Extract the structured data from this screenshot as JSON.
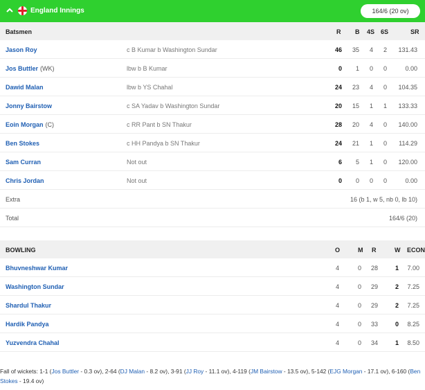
{
  "header": {
    "title": "England Innings",
    "score": "164/6 (20 ov)",
    "icons": [
      "chevron-up-icon",
      "england-flag-icon"
    ],
    "bg_color": "#2fd02f"
  },
  "batting": {
    "headers": {
      "name": "Batsmen",
      "r": "R",
      "b": "B",
      "fours": "4S",
      "sixes": "6S",
      "sr": "SR"
    },
    "rows": [
      {
        "name": "Jason Roy",
        "role": "",
        "dismissal": "c B Kumar b Washington Sundar",
        "r": "46",
        "b": "35",
        "fours": "4",
        "sixes": "2",
        "sr": "131.43"
      },
      {
        "name": "Jos Buttler",
        "role": "(WK)",
        "dismissal": "lbw b B Kumar",
        "r": "0",
        "b": "1",
        "fours": "0",
        "sixes": "0",
        "sr": "0.00"
      },
      {
        "name": "Dawid Malan",
        "role": "",
        "dismissal": "lbw b YS Chahal",
        "r": "24",
        "b": "23",
        "fours": "4",
        "sixes": "0",
        "sr": "104.35"
      },
      {
        "name": "Jonny Bairstow",
        "role": "",
        "dismissal": "c SA Yadav b Washington Sundar",
        "r": "20",
        "b": "15",
        "fours": "1",
        "sixes": "1",
        "sr": "133.33"
      },
      {
        "name": "Eoin Morgan",
        "role": "(C)",
        "dismissal": "c RR Pant b SN Thakur",
        "r": "28",
        "b": "20",
        "fours": "4",
        "sixes": "0",
        "sr": "140.00"
      },
      {
        "name": "Ben Stokes",
        "role": "",
        "dismissal": "c HH Pandya b SN Thakur",
        "r": "24",
        "b": "21",
        "fours": "1",
        "sixes": "0",
        "sr": "114.29"
      },
      {
        "name": "Sam Curran",
        "role": "",
        "dismissal": "Not out",
        "r": "6",
        "b": "5",
        "fours": "1",
        "sixes": "0",
        "sr": "120.00"
      },
      {
        "name": "Chris Jordan",
        "role": "",
        "dismissal": "Not out",
        "r": "0",
        "b": "0",
        "fours": "0",
        "sixes": "0",
        "sr": "0.00"
      }
    ],
    "extra": {
      "label": "Extra",
      "value": "16 (b 1, w 5, nb 0, lb 10)"
    },
    "total": {
      "label": "Total",
      "value": "164/6 (20)"
    }
  },
  "bowling": {
    "headers": {
      "name": "BOWLING",
      "o": "O",
      "m": "M",
      "r": "R",
      "w": "W",
      "econ": "ECON"
    },
    "rows": [
      {
        "name": "Bhuvneshwar Kumar",
        "o": "4",
        "m": "0",
        "r": "28",
        "w": "1",
        "econ": "7.00"
      },
      {
        "name": "Washington Sundar",
        "o": "4",
        "m": "0",
        "r": "29",
        "w": "2",
        "econ": "7.25"
      },
      {
        "name": "Shardul Thakur",
        "o": "4",
        "m": "0",
        "r": "29",
        "w": "2",
        "econ": "7.25"
      },
      {
        "name": "Hardik Pandya",
        "o": "4",
        "m": "0",
        "r": "33",
        "w": "0",
        "econ": "8.25"
      },
      {
        "name": "Yuzvendra Chahal",
        "o": "4",
        "m": "0",
        "r": "34",
        "w": "1",
        "econ": "8.50"
      }
    ]
  },
  "fall_of_wickets": {
    "label": "Fall of wickets:",
    "items": [
      {
        "pre": "1-1 (",
        "player": "Jos Buttler",
        "post": " - 0.3 ov), "
      },
      {
        "pre": "2-64 (",
        "player": "DJ Malan",
        "post": " - 8.2 ov), "
      },
      {
        "pre": "3-91 (",
        "player": "JJ Roy",
        "post": " - 11.1 ov), "
      },
      {
        "pre": "4-119 (",
        "player": "JM Bairstow",
        "post": " - 13.5 ov), "
      },
      {
        "pre": "5-142 (",
        "player": "EJG Morgan",
        "post": " - 17.1 ov), "
      },
      {
        "pre": "6-160 (",
        "player": "Ben Stokes",
        "post": " - 19.4 ov)"
      }
    ]
  }
}
